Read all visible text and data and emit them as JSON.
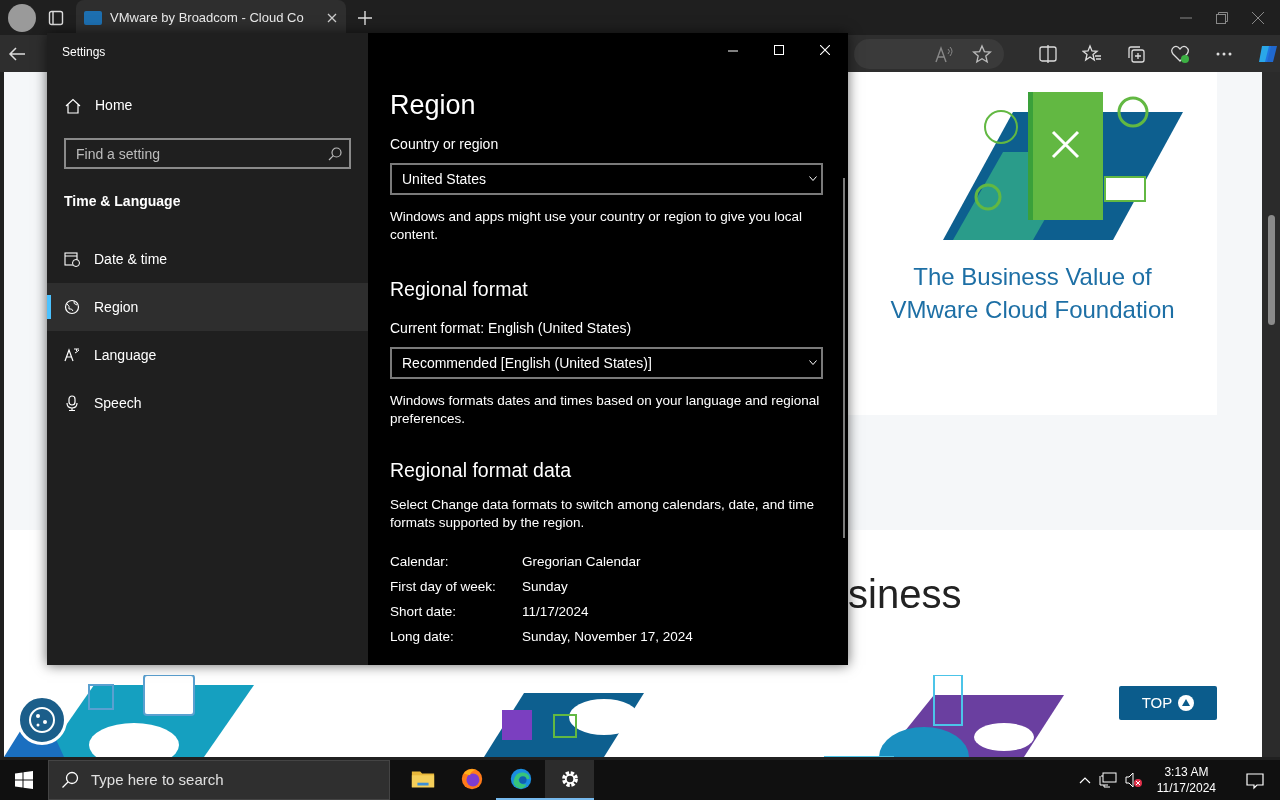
{
  "browser": {
    "tab": {
      "title": "VMware by Broadcom - Cloud Co",
      "selected": true
    }
  },
  "page": {
    "card_title": "The Business Value of VMware Cloud Foundation",
    "heading_fragment": "siness",
    "top_button": "TOP"
  },
  "settings": {
    "title": "Settings",
    "home": "Home",
    "search": {
      "placeholder": "Find a setting"
    },
    "section": "Time & Language",
    "nav": [
      {
        "label": "Date & time",
        "kind": "clock",
        "selected": false
      },
      {
        "label": "Region",
        "kind": "globe",
        "selected": true
      },
      {
        "label": "Language",
        "kind": "language",
        "selected": false
      },
      {
        "label": "Speech",
        "kind": "mic",
        "selected": false
      }
    ],
    "content": {
      "title": "Region",
      "country_label": "Country or region",
      "country_value": "United States",
      "country_help": "Windows and apps might use your country or region to give you local content.",
      "format_heading": "Regional format",
      "format_label": "Current format: English (United States)",
      "format_value": "Recommended [English (United States)]",
      "format_help": "Windows formats dates and times based on your language and regional preferences.",
      "data_heading": "Regional format data",
      "data_help": "Select Change data formats to switch among calendars, date, and time formats supported by the region.",
      "data_rows": [
        {
          "label": "Calendar:",
          "value": "Gregorian Calendar"
        },
        {
          "label": "First day of week:",
          "value": "Sunday"
        },
        {
          "label": "Short date:",
          "value": "11/17/2024"
        },
        {
          "label": "Long date:",
          "value": "Sunday, November 17, 2024"
        }
      ]
    }
  },
  "taskbar": {
    "search_placeholder": "Type here to search",
    "apps": [
      {
        "kind": "folder",
        "open": false,
        "selected": false
      },
      {
        "kind": "firefox",
        "open": false,
        "selected": false
      },
      {
        "kind": "edge",
        "open": true,
        "selected": false
      },
      {
        "kind": "gear",
        "open": true,
        "selected": true
      }
    ],
    "time": "3:13 AM",
    "date": "11/17/2024"
  }
}
